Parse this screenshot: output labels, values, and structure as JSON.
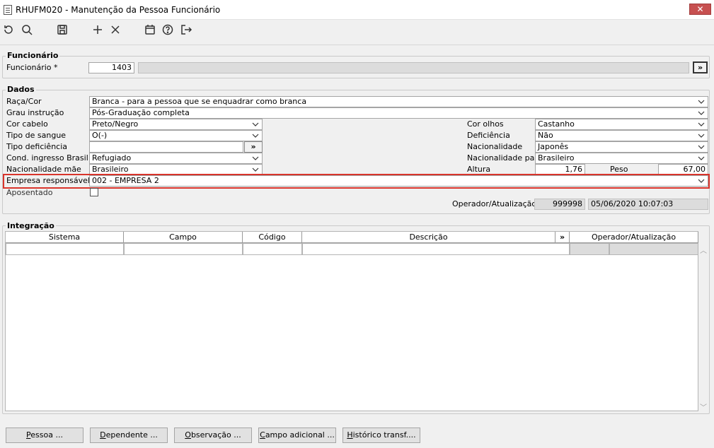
{
  "window": {
    "title": "RHUFM020 - Manutenção da Pessoa Funcionário",
    "close_label": "✕"
  },
  "toolbar": {
    "icons": [
      "undo-icon",
      "search-icon",
      "save-icon",
      "add-icon",
      "delete-icon",
      "calendar-icon",
      "help-icon",
      "exit-icon"
    ]
  },
  "funcionario_group": {
    "title": "Funcionário",
    "label": "Funcionário *",
    "code": "1403",
    "lookup_button": "»"
  },
  "dados_group": {
    "title": "Dados",
    "raca_cor": {
      "label": "Raça/Cor",
      "value": "Branca - para a pessoa que se enquadrar como branca"
    },
    "grau_instrucao": {
      "label": "Grau instrução",
      "value": "Pós-Graduação completa"
    },
    "cor_cabelo": {
      "label": "Cor cabelo",
      "value": "Preto/Negro"
    },
    "tipo_sangue": {
      "label": "Tipo de sangue",
      "value": "O(-)"
    },
    "tipo_deficiencia": {
      "label": "Tipo deficiência",
      "value": "",
      "button": "»"
    },
    "cond_ingresso": {
      "label": "Cond. ingresso Brasil",
      "value": "Refugiado"
    },
    "nacionalidade_mae": {
      "label": "Nacionalidade mãe",
      "value": "Brasileiro"
    },
    "empresa_responsavel": {
      "label": "Empresa responsável",
      "value": "002 - EMPRESA 2"
    },
    "aposentado": {
      "label": "Aposentado",
      "checked": false
    },
    "cor_olhos": {
      "label": "Cor olhos",
      "value": "Castanho"
    },
    "deficiencia": {
      "label": "Deficiência",
      "value": "Não"
    },
    "nacionalidade": {
      "label": "Nacionalidade",
      "value": "Japonês"
    },
    "nacionalidade_pai": {
      "label": "Nacionalidade pai",
      "value": "Brasileiro"
    },
    "altura": {
      "label": "Altura",
      "value": "1,76"
    },
    "peso": {
      "label": "Peso",
      "value": "67,00"
    },
    "operador": {
      "label": "Operador/Atualização",
      "code": "999998",
      "datetime": "05/06/2020 10:07:03"
    }
  },
  "integracao_group": {
    "title": "Integração",
    "columns": [
      "Sistema",
      "Campo",
      "Código",
      "Descrição",
      "»",
      "Operador/Atualização"
    ]
  },
  "bottom_buttons": [
    {
      "first": "P",
      "rest": "essoa ..."
    },
    {
      "first": "D",
      "rest": "ependente ..."
    },
    {
      "first": "O",
      "rest": "bservação ..."
    },
    {
      "first": "C",
      "rest": "ampo adicional ..."
    },
    {
      "first": "H",
      "rest": "istórico transf...."
    }
  ],
  "colors": {
    "highlight": "#d9342b",
    "close_button": "#c75050",
    "readonly_field": "#dcdcdc"
  }
}
